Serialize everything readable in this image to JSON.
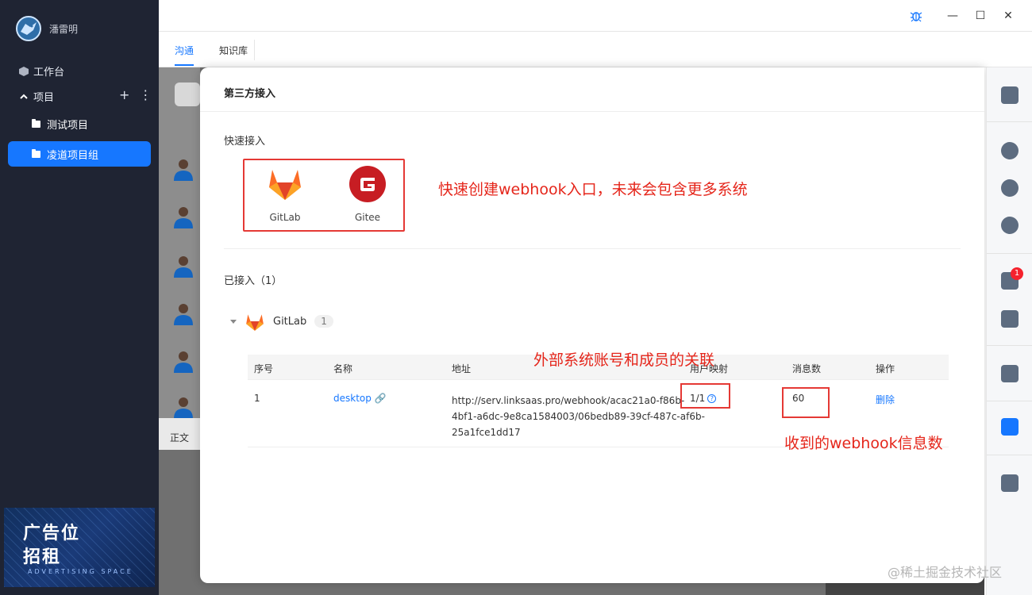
{
  "user": {
    "name": "潘雷明"
  },
  "nav": {
    "workbench": "工作台",
    "projects": "项目"
  },
  "projects": [
    {
      "label": "测试项目",
      "active": false
    },
    {
      "label": "凌道项目组",
      "active": true
    }
  ],
  "ad": {
    "line1": "广告位",
    "line2": "招租",
    "sub": "ADVERTISING SPACE"
  },
  "window": {
    "bug": "bug-icon",
    "minimize": "—",
    "maximize": "☐",
    "close": "✕"
  },
  "tabs": [
    {
      "label": "沟通",
      "active": true
    },
    {
      "label": "知识库",
      "active": false
    }
  ],
  "background": {
    "footer_label": "正文"
  },
  "panel": {
    "title": "第三方接入",
    "quick_label": "快速接入",
    "quick_items": [
      {
        "label": "GitLab",
        "icon": "gitlab-icon"
      },
      {
        "label": "Gitee",
        "icon": "gitee-icon"
      }
    ],
    "connected_label": "已接入（1）",
    "group": {
      "name": "GitLab",
      "count": "1"
    },
    "table": {
      "headers": [
        "序号",
        "名称",
        "地址",
        "用户映射",
        "消息数",
        "操作"
      ],
      "rows": [
        {
          "index": "1",
          "name": "desktop",
          "url_lines": [
            "http://serv.linksaas.pro/webhook/acac21a0-f86b-",
            "4bf1-a6dc-9e8ca1584003/06bedb89-39cf-487c-af6b-",
            "25a1fce1dd17"
          ],
          "user_mapping": "1/1",
          "message_count": "60",
          "action": "删除"
        }
      ]
    }
  },
  "annotations": {
    "quick": "快速创建webhook入口，未来会包含更多系统",
    "mapping": "外部系统账号和成员的关联",
    "messages": "收到的webhook信息数"
  },
  "rightbar": {
    "badge": "1"
  },
  "watermark": "@稀土掘金技术社区",
  "colors": {
    "accent": "#1677ff",
    "annotation": "#e5261b",
    "sidebar": "#1f2433"
  }
}
